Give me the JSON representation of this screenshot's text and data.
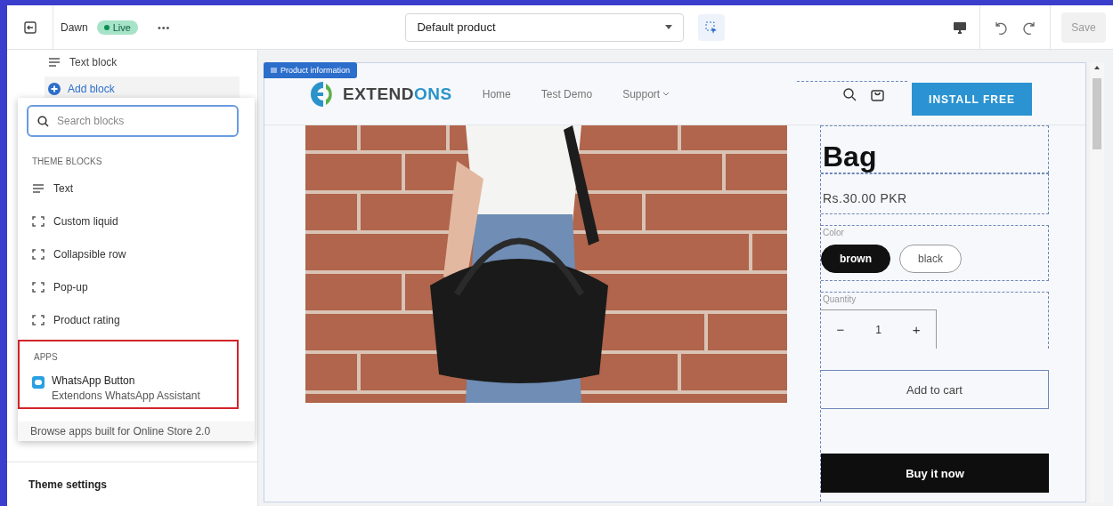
{
  "topbar": {
    "theme_name": "Dawn",
    "status": "Live",
    "more": "•••",
    "template": "Default product",
    "save": "Save"
  },
  "sidebar": {
    "items": [
      {
        "label": "Text block"
      }
    ],
    "add_block": "Add block",
    "theme_settings": "Theme settings"
  },
  "block_picker": {
    "search": {
      "placeholder": "Search blocks"
    },
    "theme_blocks": {
      "heading": "THEME BLOCKS",
      "items": [
        {
          "label": "Text",
          "kind": "text"
        },
        {
          "label": "Custom liquid",
          "kind": "liquid"
        },
        {
          "label": "Collapsible row",
          "kind": "liquid"
        },
        {
          "label": "Pop-up",
          "kind": "liquid"
        },
        {
          "label": "Product rating",
          "kind": "liquid"
        }
      ]
    },
    "apps": {
      "heading": "APPS",
      "highlighted": true,
      "items": [
        {
          "title": "WhatsApp Button",
          "subtitle": "Extendons WhatsApp Assistant"
        }
      ]
    },
    "browse_link": "Browse apps built for Online Store 2.0"
  },
  "preview": {
    "section_tag": "Product information",
    "logo": {
      "dark": "EXTEND",
      "accent": "ONS"
    },
    "nav": [
      {
        "label": "Home",
        "dropdown": false
      },
      {
        "label": "Test Demo",
        "dropdown": false
      },
      {
        "label": "Support",
        "dropdown": true
      }
    ],
    "install_button": "INSTALL FREE",
    "product": {
      "title": "Bag",
      "price": "Rs.30.00 PKR",
      "color_label": "Color",
      "options": [
        {
          "label": "brown",
          "selected": true
        },
        {
          "label": "black",
          "selected": false
        }
      ],
      "quantity_label": "Quantity",
      "minus": "−",
      "quantity": "1",
      "plus": "+",
      "add_to_cart": "Add to cart",
      "buy_now": "Buy it now"
    }
  }
}
